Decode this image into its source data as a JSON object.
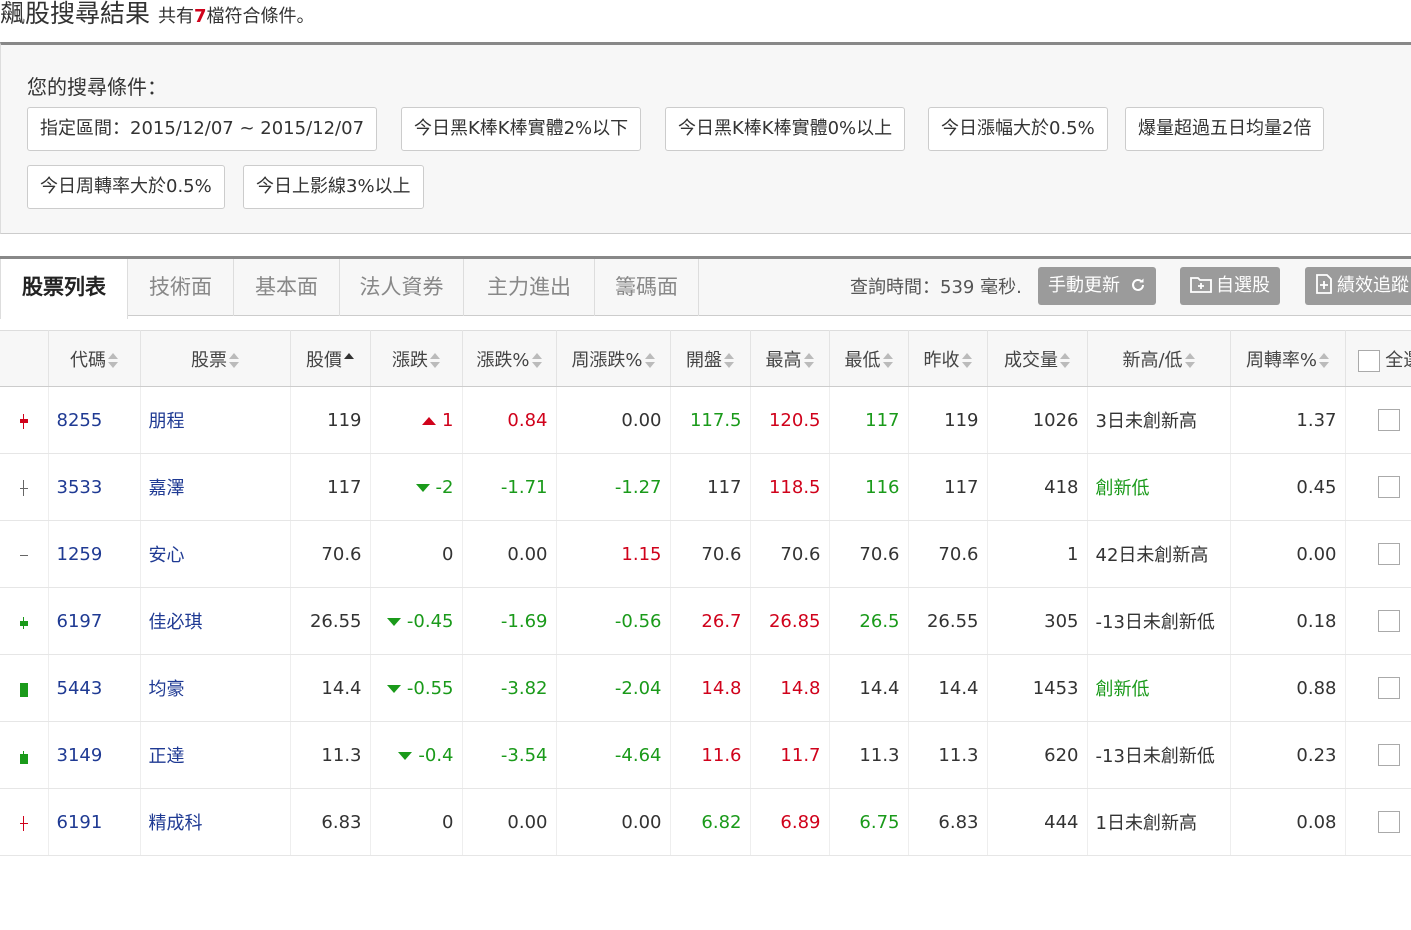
{
  "header": {
    "title": "飆股搜尋結果",
    "summary_prefix": "共有",
    "count": "7",
    "summary_suffix": "檔符合條件。"
  },
  "conditions": {
    "title": "您的搜尋條件：",
    "chips": [
      "指定區間：2015/12/07 ~ 2015/12/07",
      "今日黑K棒K棒實體2%以下",
      "今日黑K棒K棒實體0%以上",
      "今日漲幅大於0.5%",
      "爆量超過五日均量2倍",
      "今日周轉率大於0.5%",
      "今日上影線3%以上"
    ]
  },
  "tabs": {
    "items": [
      "股票列表",
      "技術面",
      "基本面",
      "法人資券",
      "主力進出",
      "籌碼面"
    ],
    "active": 0,
    "query_time": "查詢時間：539 毫秒.",
    "refresh_label": "手動更新",
    "watchlist_label": "自選股",
    "track_label": "績效追蹤"
  },
  "table": {
    "headers": [
      "代碼",
      "股票",
      "股價",
      "漲跌",
      "漲跌%",
      "周漲跌%",
      "開盤",
      "最高",
      "最低",
      "昨收",
      "成交量",
      "新高/低",
      "周轉率%",
      "全選"
    ],
    "colors": {
      "up": "#d0021b",
      "down": "#1a9a1a",
      "flat": "#333333",
      "link": "#1f3a93"
    },
    "rows": [
      {
        "code": "8255",
        "name": "朋程",
        "price": "119",
        "chg": "1",
        "pct": "0.84",
        "wpct": "0.00",
        "open": "117.5",
        "high": "120.5",
        "low": "117",
        "prev": "119",
        "vol": "1026",
        "hl": "3日未創新高",
        "turn": "1.37",
        "k": {
          "color": "#d0021b",
          "wick": [
            2,
            17
          ],
          "body": [
            7,
            11
          ]
        }
      },
      {
        "code": "3533",
        "name": "嘉澤",
        "price": "117",
        "chg": "-2",
        "pct": "-1.71",
        "wpct": "-1.27",
        "open": "117",
        "high": "118.5",
        "low": "116",
        "prev": "117",
        "vol": "418",
        "hl": "創新低",
        "turn": "0.45",
        "k": {
          "color": "#666666",
          "wick": [
            1,
            17
          ],
          "body": [
            9,
            10
          ]
        }
      },
      {
        "code": "1259",
        "name": "安心",
        "price": "70.6",
        "chg": "0",
        "pct": "0.00",
        "wpct": "1.15",
        "open": "70.6",
        "high": "70.6",
        "low": "70.6",
        "prev": "70.6",
        "vol": "1",
        "hl": "42日未創新高",
        "turn": "0.00",
        "k": {
          "color": "#666666",
          "wick": [
            9,
            10
          ],
          "body": [
            9,
            10
          ]
        }
      },
      {
        "code": "6197",
        "name": "佳必琪",
        "price": "26.55",
        "chg": "-0.45",
        "pct": "-1.69",
        "wpct": "-0.56",
        "open": "26.7",
        "high": "26.85",
        "low": "26.5",
        "prev": "26.55",
        "vol": "305",
        "hl": "-13日未創新低",
        "turn": "0.18",
        "k": {
          "color": "#1a9a1a",
          "wick": [
            4,
            16
          ],
          "body": [
            8,
            13
          ]
        }
      },
      {
        "code": "5443",
        "name": "均豪",
        "price": "14.4",
        "chg": "-0.55",
        "pct": "-3.82",
        "wpct": "-2.04",
        "open": "14.8",
        "high": "14.8",
        "low": "14.4",
        "prev": "14.4",
        "vol": "1453",
        "hl": "創新低",
        "turn": "0.88",
        "k": {
          "color": "#1a9a1a",
          "wick": [
            3,
            17
          ],
          "body": [
            3,
            17
          ]
        }
      },
      {
        "code": "3149",
        "name": "正達",
        "price": "11.3",
        "chg": "-0.4",
        "pct": "-3.54",
        "wpct": "-4.64",
        "open": "11.6",
        "high": "11.7",
        "low": "11.3",
        "prev": "11.3",
        "vol": "620",
        "hl": "-13日未創新低",
        "turn": "0.23",
        "k": {
          "color": "#1a9a1a",
          "wick": [
            4,
            17
          ],
          "body": [
            7,
            17
          ]
        }
      },
      {
        "code": "6191",
        "name": "精成科",
        "price": "6.83",
        "chg": "0",
        "pct": "0.00",
        "wpct": "0.00",
        "open": "6.82",
        "high": "6.89",
        "low": "6.75",
        "prev": "6.83",
        "vol": "444",
        "hl": "1日未創新高",
        "turn": "0.08",
        "k": {
          "color": "#d0021b",
          "wick": [
            2,
            17
          ],
          "body": [
            9,
            10
          ]
        }
      }
    ]
  }
}
